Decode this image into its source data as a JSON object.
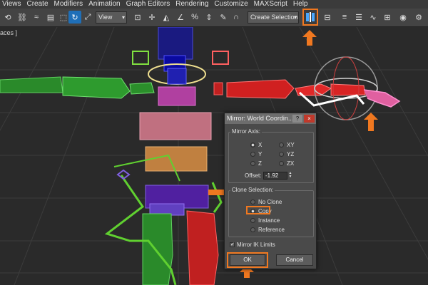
{
  "menubar": {
    "items": [
      "Views",
      "Create",
      "Modifiers",
      "Animation",
      "Graph Editors",
      "Rendering",
      "Customize",
      "MAXScript",
      "Help"
    ]
  },
  "toolbar": {
    "view_select": "View",
    "selection_set_select": "Create Selection Se"
  },
  "viewport": {
    "label": "aces ]"
  },
  "dialog": {
    "title": "Mirror: World Coordin...",
    "help": "?",
    "close": "×",
    "mirror_axis": {
      "label": "Mirror Axis:",
      "options": [
        "X",
        "Y",
        "Z",
        "XY",
        "YZ",
        "ZX"
      ],
      "selected": "X",
      "offset_label": "Offset:",
      "offset_value": "-1.92"
    },
    "clone_selection": {
      "label": "Clone Selection:",
      "options": [
        "No Clone",
        "Copy",
        "Instance",
        "Reference"
      ],
      "selected": "Copy"
    },
    "mirror_ik_label": "Mirror IK Limits",
    "mirror_ik_checked": true,
    "ok_label": "OK",
    "cancel_label": "Cancel"
  },
  "colors": {
    "accent": "#f07820",
    "toolbar_active": "#1f6fb8",
    "viewport_bg": "#2a2a2a",
    "grid": "#3a3a3a"
  }
}
